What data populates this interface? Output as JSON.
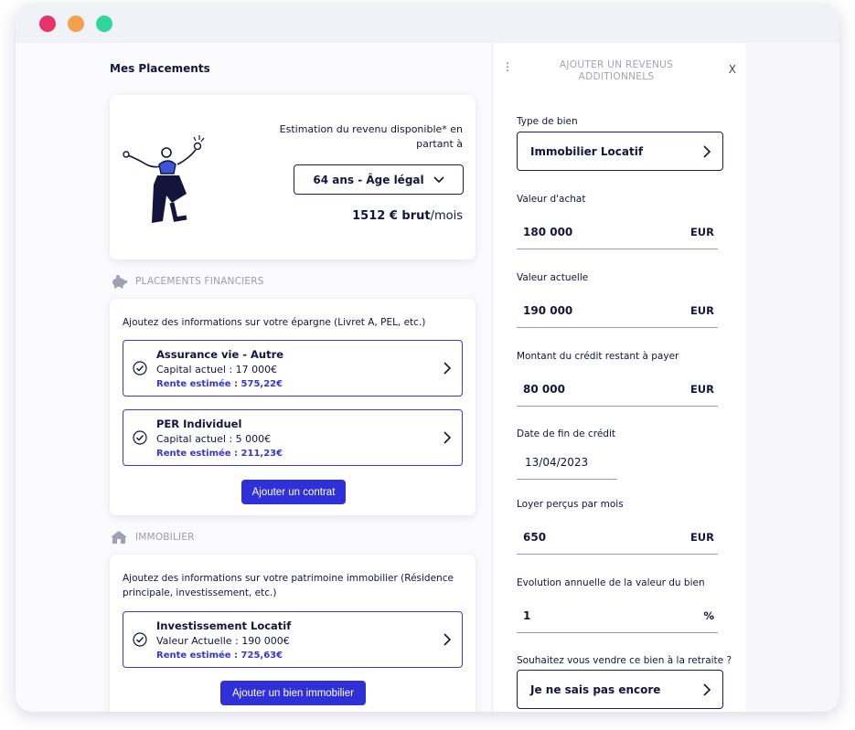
{
  "window": {
    "controls": [
      "close",
      "minimize",
      "maximize"
    ]
  },
  "left": {
    "section_title": "Mes Placements",
    "hero": {
      "estimate_label": "Estimation du revenu disponible* en partant à",
      "age_select": "64 ans - Âge légal",
      "income_amount": "1512 € brut",
      "income_unit": "/mois"
    },
    "financial": {
      "header": "PLACEMENTS FINANCIERS",
      "intro": "Ajoutez des informations sur votre épargne (Livret A, PEL, etc.)",
      "contracts": [
        {
          "name": "Assurance vie - Autre",
          "capital": "Capital actuel : 17 000€",
          "rente": "Rente estimée : 575,22€"
        },
        {
          "name": "PER Individuel",
          "capital": "Capital actuel : 5 000€",
          "rente": "Rente estimée : 211,23€"
        }
      ],
      "add_button": "Ajouter un contrat"
    },
    "realestate": {
      "header": "IMMOBILIER",
      "intro": "Ajoutez des informations sur votre patrimoine immobilier (Résidence principale, investissement, etc.)",
      "properties": [
        {
          "name": "Investissement Locatif",
          "value": "Valeur Actuelle : 190 000€",
          "rente": "Rente estimée : 725,63€"
        }
      ],
      "add_button": "Ajouter un bien immobilier"
    }
  },
  "panel": {
    "menu_icon": "⋮",
    "title": "AJOUTER UN REVENUS ADDITIONNELS",
    "close_label": "X",
    "fields": {
      "type": {
        "label": "Type de bien",
        "value": "Immobilier Locatif"
      },
      "purchase": {
        "label": "Valeur d'achat",
        "value": "180 000",
        "unit": "EUR"
      },
      "current": {
        "label": "Valeur actuelle",
        "value": "190 000",
        "unit": "EUR"
      },
      "credit": {
        "label": "Montant du crédit restant à payer",
        "value": "80 000",
        "unit": "EUR"
      },
      "credit_end": {
        "label": "Date de fin de crédit",
        "value": "13/04/2023"
      },
      "rent": {
        "label": "Loyer perçus par mois",
        "value": "650",
        "unit": "EUR"
      },
      "growth": {
        "label": "Evolution annuelle de la valeur du bien",
        "value": "1",
        "unit": "%"
      },
      "sell": {
        "label": "Souhaitez vous vendre ce bien à la retraite ?",
        "value": "Je ne sais pas encore"
      }
    }
  },
  "colors": {
    "primary": "#3030d8",
    "navy": "#14143c",
    "muted": "#9b9bb0"
  },
  "icons": [
    "piggy-bank-icon",
    "house-icon",
    "check-circle-icon",
    "chevron-right-icon",
    "chevron-down-icon",
    "kebab-menu-icon",
    "close-icon"
  ]
}
